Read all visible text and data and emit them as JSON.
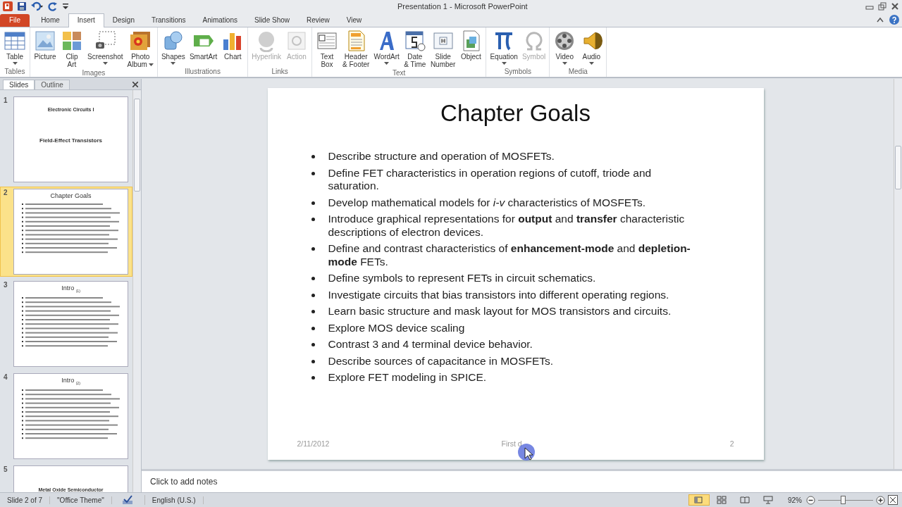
{
  "window": {
    "title": "Presentation 1  -  Microsoft PowerPoint"
  },
  "tabs": [
    {
      "label": "File",
      "kind": "file",
      "selected": false
    },
    {
      "label": "Home",
      "kind": "tab",
      "selected": false
    },
    {
      "label": "Insert",
      "kind": "tab",
      "selected": true
    },
    {
      "label": "Design",
      "kind": "tab",
      "selected": false
    },
    {
      "label": "Transitions",
      "kind": "tab",
      "selected": false
    },
    {
      "label": "Animations",
      "kind": "tab",
      "selected": false
    },
    {
      "label": "Slide Show",
      "kind": "tab",
      "selected": false
    },
    {
      "label": "Review",
      "kind": "tab",
      "selected": false
    },
    {
      "label": "View",
      "kind": "tab",
      "selected": false
    }
  ],
  "ribbon_groups": [
    {
      "label": "Tables",
      "commands": [
        {
          "lines": [
            "Table"
          ],
          "dropdown": true,
          "disabled": false
        }
      ]
    },
    {
      "label": "Images",
      "commands": [
        {
          "lines": [
            "Picture"
          ],
          "dropdown": false,
          "disabled": false
        },
        {
          "lines": [
            "Clip",
            "Art"
          ],
          "dropdown": false,
          "disabled": false
        },
        {
          "lines": [
            "Screenshot"
          ],
          "dropdown": true,
          "disabled": false
        },
        {
          "lines": [
            "Photo",
            "Album"
          ],
          "dropdown": true,
          "disabled": false
        }
      ]
    },
    {
      "label": "Illustrations",
      "commands": [
        {
          "lines": [
            "Shapes"
          ],
          "dropdown": true,
          "disabled": false
        },
        {
          "lines": [
            "SmartArt"
          ],
          "dropdown": false,
          "disabled": false
        },
        {
          "lines": [
            "Chart"
          ],
          "dropdown": false,
          "disabled": false
        }
      ]
    },
    {
      "label": "Links",
      "commands": [
        {
          "lines": [
            "Hyperlink"
          ],
          "dropdown": false,
          "disabled": true
        },
        {
          "lines": [
            "Action"
          ],
          "dropdown": false,
          "disabled": true
        }
      ]
    },
    {
      "label": "Text",
      "commands": [
        {
          "lines": [
            "Text",
            "Box"
          ],
          "dropdown": false,
          "disabled": false
        },
        {
          "lines": [
            "Header",
            "& Footer"
          ],
          "dropdown": false,
          "disabled": false
        },
        {
          "lines": [
            "WordArt"
          ],
          "dropdown": true,
          "disabled": false
        },
        {
          "lines": [
            "Date",
            "& Time"
          ],
          "dropdown": false,
          "disabled": false
        },
        {
          "lines": [
            "Slide",
            "Number"
          ],
          "dropdown": false,
          "disabled": false
        },
        {
          "lines": [
            "Object"
          ],
          "dropdown": false,
          "disabled": false
        }
      ]
    },
    {
      "label": "Symbols",
      "commands": [
        {
          "lines": [
            "Equation"
          ],
          "dropdown": true,
          "disabled": false
        },
        {
          "lines": [
            "Symbol"
          ],
          "dropdown": false,
          "disabled": true
        }
      ]
    },
    {
      "label": "Media",
      "commands": [
        {
          "lines": [
            "Video"
          ],
          "dropdown": true,
          "disabled": false
        },
        {
          "lines": [
            "Audio"
          ],
          "dropdown": true,
          "disabled": false
        }
      ]
    }
  ],
  "panel_tabs": [
    {
      "label": "Slides",
      "selected": true
    },
    {
      "label": "Outline",
      "selected": false
    }
  ],
  "thumbnails": [
    {
      "number": "1",
      "kind": "title",
      "selected": false,
      "heading": "Electronic Circuits I",
      "title": "Field-Effect Transistors"
    },
    {
      "number": "2",
      "kind": "content",
      "selected": true,
      "title": "Chapter Goals"
    },
    {
      "number": "3",
      "kind": "content",
      "selected": false,
      "title": "Intro $_{(1)}$"
    },
    {
      "number": "4",
      "kind": "content",
      "selected": false,
      "title": "Intro $_{(2)}$"
    },
    {
      "number": "5",
      "kind": "section",
      "selected": false,
      "title": "Metal Oxide Semiconductor"
    }
  ],
  "slide": {
    "title": "Chapter Goals",
    "bullets": [
      "Describe structure and operation of MOSFETs.",
      "Define FET characteristics  in operation regions of cutoff, triode and saturation.",
      "Develop mathematical models for *i-v* characteristics of MOSFETs.",
      "Introduce graphical representations for **output** and **transfer** characteristic descriptions of electron devices.",
      "Define and contrast characteristics  of **enhancement-mode** and **depletion-mode** FETs.",
      "Define symbols to represent FETs in circuit schematics.",
      "Investigate circuits that bias transistors into different operating regions.",
      "Learn basic structure and mask layout for MOS transistors and circuits.",
      "Explore MOS device scaling",
      "Contrast 3 and 4 terminal device behavior.",
      "Describe sources of capacitance in MOSFETs.",
      "Explore FET modeling in SPICE."
    ],
    "footer": {
      "date": "2/11/2012",
      "center": "First d",
      "number": "2"
    }
  },
  "notes": {
    "placeholder": "Click to add notes"
  },
  "status_bar": {
    "slide": "Slide 2 of 7",
    "theme": "\"Office Theme\"",
    "language": "English (U.S.)",
    "views": [
      {
        "selected": true
      },
      {
        "selected": false
      },
      {
        "selected": false
      },
      {
        "selected": false
      }
    ],
    "zoom": "92%",
    "zoom_slider": {
      "level": 0.45
    }
  }
}
